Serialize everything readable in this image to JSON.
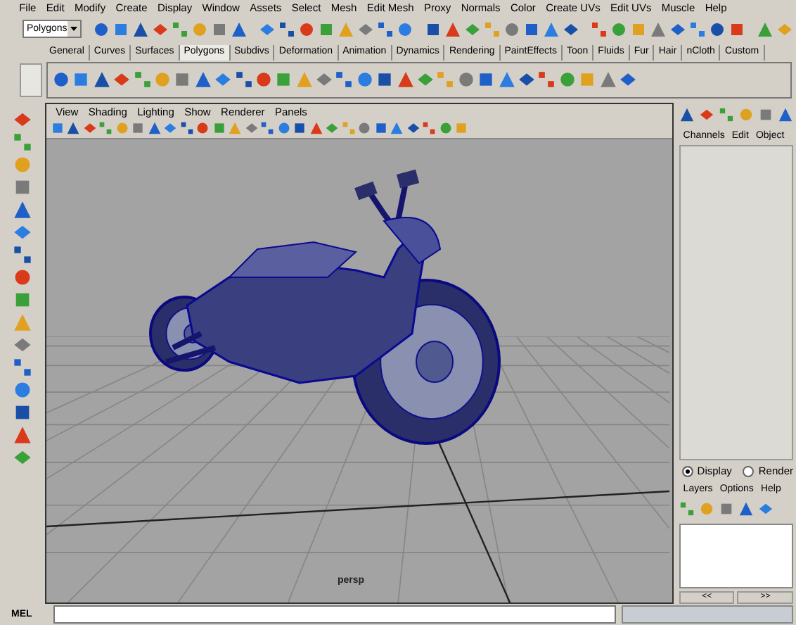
{
  "menu_bar": [
    "File",
    "Edit",
    "Modify",
    "Create",
    "Display",
    "Window",
    "Assets",
    "Select",
    "Mesh",
    "Edit Mesh",
    "Proxy",
    "Normals",
    "Color",
    "Create UVs",
    "Edit UVs",
    "Muscle",
    "Help"
  ],
  "status_line": {
    "menu_set": "Polygons"
  },
  "shelf_tabs": [
    {
      "label": "General",
      "selected": false
    },
    {
      "label": "Curves",
      "selected": false
    },
    {
      "label": "Surfaces",
      "selected": false
    },
    {
      "label": "Polygons",
      "selected": true
    },
    {
      "label": "Subdivs",
      "selected": false
    },
    {
      "label": "Deformation",
      "selected": false
    },
    {
      "label": "Animation",
      "selected": false
    },
    {
      "label": "Dynamics",
      "selected": false
    },
    {
      "label": "Rendering",
      "selected": false
    },
    {
      "label": "PaintEffects",
      "selected": false
    },
    {
      "label": "Toon",
      "selected": false
    },
    {
      "label": "Fluids",
      "selected": false
    },
    {
      "label": "Fur",
      "selected": false
    },
    {
      "label": "Hair",
      "selected": false
    },
    {
      "label": "nCloth",
      "selected": false
    },
    {
      "label": "Custom",
      "selected": false
    }
  ],
  "viewport": {
    "menu": [
      "View",
      "Shading",
      "Lighting",
      "Show",
      "Renderer",
      "Panels"
    ],
    "camera_label": "persp"
  },
  "channel_box": {
    "menu": [
      "Channels",
      "Edit",
      "Object"
    ]
  },
  "layer_editor": {
    "modes": [
      {
        "label": "Display",
        "selected": true
      },
      {
        "label": "Render",
        "selected": false
      }
    ],
    "menu": [
      "Layers",
      "Options",
      "Help"
    ],
    "page_buttons": [
      "<<",
      ">>"
    ]
  },
  "command_line": {
    "label": "MEL"
  }
}
